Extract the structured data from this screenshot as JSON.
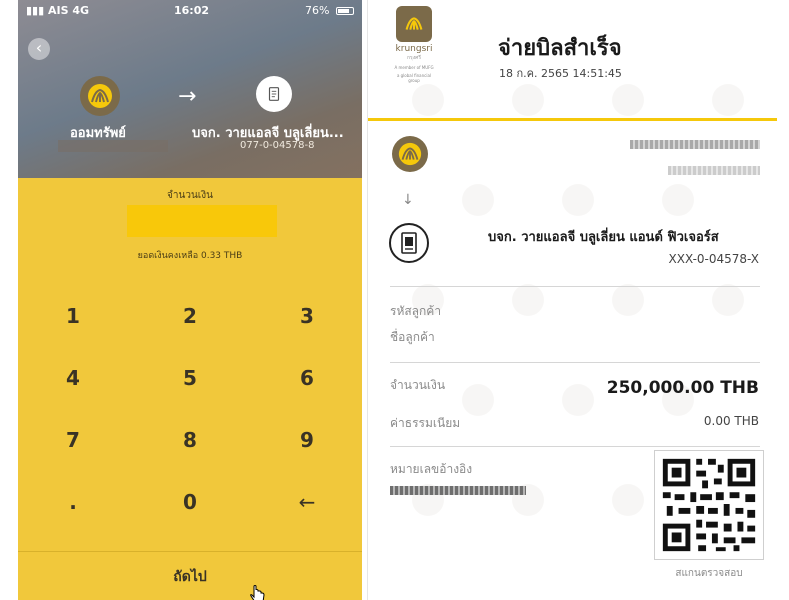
{
  "status_bar": {
    "carrier": "AIS",
    "network": "4G",
    "time": "16:02",
    "battery": "76%"
  },
  "transfer": {
    "from_name": "ออมทรัพย์",
    "to_name": "บจก. วายแอลจี บลูเลี่ยน...",
    "to_account": "077-0-04578-8"
  },
  "amount_section": {
    "label": "จำนวนเงิน",
    "balance_text": "ยอดเงินคงเหลือ 0.33 THB"
  },
  "keypad": {
    "keys": [
      "1",
      "2",
      "3",
      "4",
      "5",
      "6",
      "7",
      "8",
      "9",
      ".",
      "0",
      "←"
    ]
  },
  "next_button": {
    "label": "ถัดไป"
  },
  "receipt": {
    "logo_word": "krungsri",
    "logo_sub": "กรุงศรี",
    "logo_tagline_1": "A member of MUFG",
    "logo_tagline_2": "a global financial group",
    "title": "จ่ายบิลสำเร็จ",
    "datetime": "18 ก.ค. 2565 14:51:45",
    "payee_name": "บจก. วายแอลจี บลูเลี่ยน แอนด์ ฟิวเจอร์ส",
    "payee_account": "XXX-0-04578-X",
    "customer_code_label": "รหัสลูกค้า",
    "customer_name_label": "ชื่อลูกค้า",
    "amount_label": "จำนวนเงิน",
    "amount_value": "250,000.00 THB",
    "fee_label": "ค่าธรรมเนียม",
    "fee_value": "0.00 THB",
    "reference_label": "หมายเลขอ้างอิง",
    "qr_label": "สแกนตรวจสอบ"
  },
  "colors": {
    "brand_yellow": "#f1c83b",
    "brand_gold": "#7b6a49",
    "accent_yellow": "#f5c80b"
  }
}
